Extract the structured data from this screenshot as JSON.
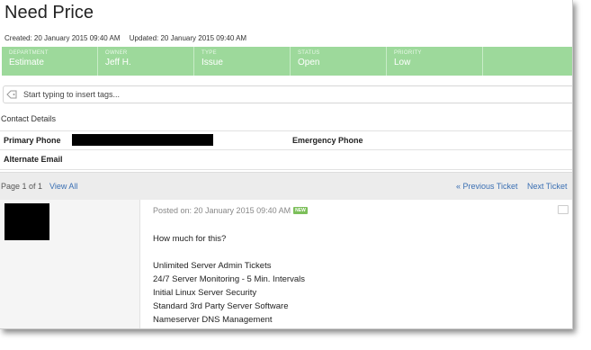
{
  "ticket": {
    "title": "Need Price",
    "created": "Created: 20 January 2015 09:40 AM",
    "updated": "Updated: 20 January 2015 09:40 AM"
  },
  "status_bar": {
    "color": "#9dd99b",
    "cells": [
      {
        "label": "DEPARTMENT",
        "value": "Estimate"
      },
      {
        "label": "OWNER",
        "value": "Jeff H."
      },
      {
        "label": "TYPE",
        "value": "Issue"
      },
      {
        "label": "STATUS",
        "value": "Open"
      },
      {
        "label": "PRIORITY",
        "value": "Low"
      }
    ]
  },
  "tags": {
    "placeholder": "Start typing to insert tags..."
  },
  "contact": {
    "section_title": "Contact Details",
    "primary_phone_label": "Primary Phone",
    "emergency_phone_label": "Emergency Phone",
    "alternate_email_label": "Alternate Email"
  },
  "pager": {
    "page_text": "Page 1 of 1",
    "view_all": "View All",
    "previous": "« Previous Ticket",
    "next": "Next Ticket"
  },
  "post": {
    "posted_on": "Posted on: 20 January 2015 09:40 AM",
    "badge": "NEW",
    "lines": [
      "How much for this?",
      "",
      "Unlimited Server Admin Tickets",
      "24/7 Server Monitoring - 5 Min. Intervals",
      "Initial Linux Server Security",
      "Standard 3rd Party Server Software",
      "Nameserver DNS Management"
    ]
  }
}
